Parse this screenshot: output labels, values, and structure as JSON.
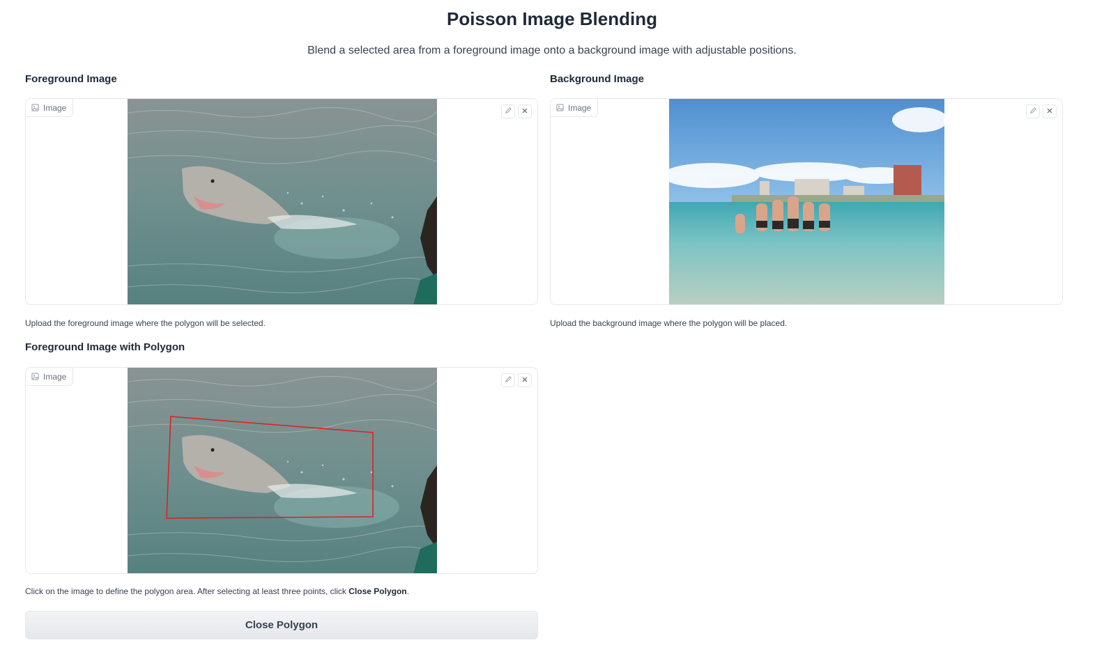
{
  "header": {
    "title": "Poisson Image Blending",
    "subtitle": "Blend a selected area from a foreground image onto a background image with adjustable positions."
  },
  "foreground": {
    "label": "Foreground Image",
    "badge": "Image",
    "hint": "Upload the foreground image where the polygon will be selected."
  },
  "background": {
    "label": "Background Image",
    "badge": "Image",
    "hint": "Upload the background image where the polygon will be placed."
  },
  "polygon_view": {
    "label": "Foreground Image with Polygon",
    "badge": "Image",
    "hint_before": "Click on the image to define the polygon area. After selecting at least three points, click ",
    "hint_bold": "Close Polygon",
    "hint_after": "."
  },
  "actions": {
    "close_polygon": "Close Polygon"
  },
  "colors": {
    "polygon_stroke": "#e11d1d",
    "panel_border": "#e5e7eb",
    "water": "#6f8f8f",
    "sky": "#5b9bd5"
  },
  "icons": [
    "image-icon",
    "pencil-icon",
    "close-icon"
  ]
}
